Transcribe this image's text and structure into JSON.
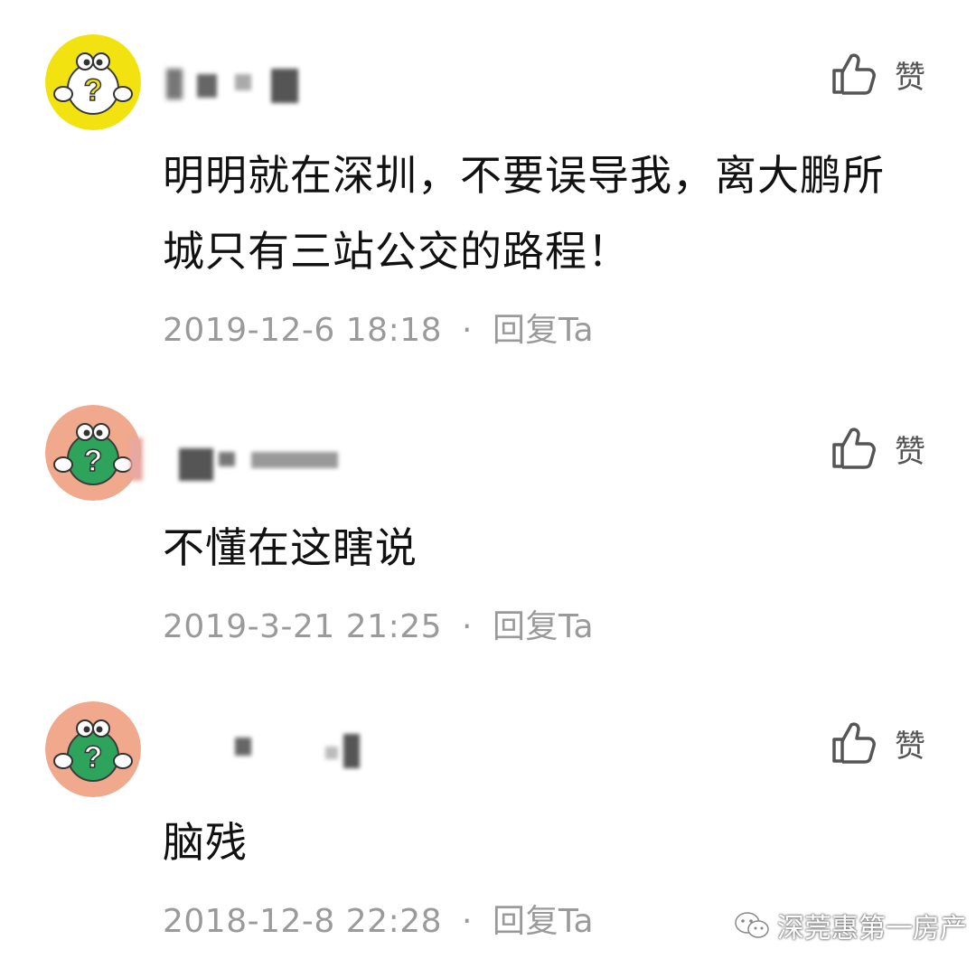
{
  "like_label": "赞",
  "comments": [
    {
      "text": "明明就在深圳，不要误导我，离大鹏所城只有三站公交的路程！",
      "time": "2019-12-6 18:18",
      "reply_label": "回复Ta",
      "avatar_bg": "#f2e20f",
      "avatar_fg": "#ffffff"
    },
    {
      "text": "不懂在这瞎说",
      "time": "2019-3-21 21:25",
      "reply_label": "回复Ta",
      "avatar_bg": "#f0a98c",
      "avatar_fg": "#2ea35b"
    },
    {
      "text": "脑残",
      "time": "2018-12-8 22:28",
      "reply_label": "回复Ta",
      "avatar_bg": "#f0a98c",
      "avatar_fg": "#2ea35b"
    }
  ],
  "watermark": {
    "text": "深莞惠第一房产",
    "icon": "wechat-logo-icon"
  },
  "colors": {
    "text": "#111111",
    "meta": "#9a9a9a",
    "icon": "#555555"
  }
}
